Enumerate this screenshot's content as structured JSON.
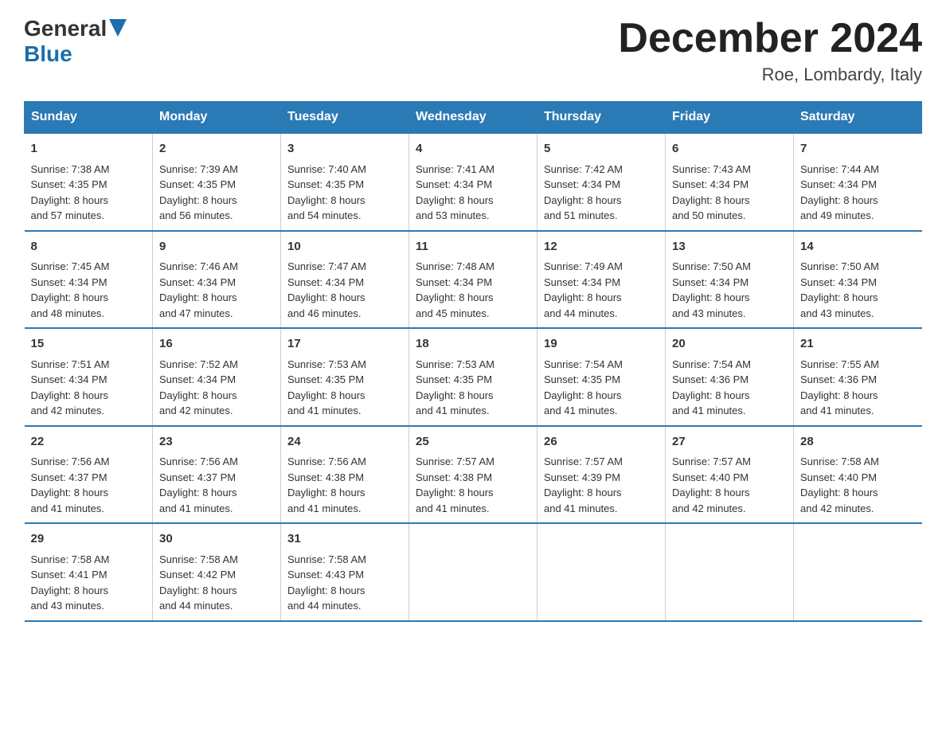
{
  "logo": {
    "general": "General",
    "arrow": "▶",
    "blue": "Blue"
  },
  "title": "December 2024",
  "location": "Roe, Lombardy, Italy",
  "days_header": [
    "Sunday",
    "Monday",
    "Tuesday",
    "Wednesday",
    "Thursday",
    "Friday",
    "Saturday"
  ],
  "weeks": [
    [
      {
        "day": "1",
        "sunrise": "7:38 AM",
        "sunset": "4:35 PM",
        "daylight": "8 hours and 57 minutes."
      },
      {
        "day": "2",
        "sunrise": "7:39 AM",
        "sunset": "4:35 PM",
        "daylight": "8 hours and 56 minutes."
      },
      {
        "day": "3",
        "sunrise": "7:40 AM",
        "sunset": "4:35 PM",
        "daylight": "8 hours and 54 minutes."
      },
      {
        "day": "4",
        "sunrise": "7:41 AM",
        "sunset": "4:34 PM",
        "daylight": "8 hours and 53 minutes."
      },
      {
        "day": "5",
        "sunrise": "7:42 AM",
        "sunset": "4:34 PM",
        "daylight": "8 hours and 51 minutes."
      },
      {
        "day": "6",
        "sunrise": "7:43 AM",
        "sunset": "4:34 PM",
        "daylight": "8 hours and 50 minutes."
      },
      {
        "day": "7",
        "sunrise": "7:44 AM",
        "sunset": "4:34 PM",
        "daylight": "8 hours and 49 minutes."
      }
    ],
    [
      {
        "day": "8",
        "sunrise": "7:45 AM",
        "sunset": "4:34 PM",
        "daylight": "8 hours and 48 minutes."
      },
      {
        "day": "9",
        "sunrise": "7:46 AM",
        "sunset": "4:34 PM",
        "daylight": "8 hours and 47 minutes."
      },
      {
        "day": "10",
        "sunrise": "7:47 AM",
        "sunset": "4:34 PM",
        "daylight": "8 hours and 46 minutes."
      },
      {
        "day": "11",
        "sunrise": "7:48 AM",
        "sunset": "4:34 PM",
        "daylight": "8 hours and 45 minutes."
      },
      {
        "day": "12",
        "sunrise": "7:49 AM",
        "sunset": "4:34 PM",
        "daylight": "8 hours and 44 minutes."
      },
      {
        "day": "13",
        "sunrise": "7:50 AM",
        "sunset": "4:34 PM",
        "daylight": "8 hours and 43 minutes."
      },
      {
        "day": "14",
        "sunrise": "7:50 AM",
        "sunset": "4:34 PM",
        "daylight": "8 hours and 43 minutes."
      }
    ],
    [
      {
        "day": "15",
        "sunrise": "7:51 AM",
        "sunset": "4:34 PM",
        "daylight": "8 hours and 42 minutes."
      },
      {
        "day": "16",
        "sunrise": "7:52 AM",
        "sunset": "4:34 PM",
        "daylight": "8 hours and 42 minutes."
      },
      {
        "day": "17",
        "sunrise": "7:53 AM",
        "sunset": "4:35 PM",
        "daylight": "8 hours and 41 minutes."
      },
      {
        "day": "18",
        "sunrise": "7:53 AM",
        "sunset": "4:35 PM",
        "daylight": "8 hours and 41 minutes."
      },
      {
        "day": "19",
        "sunrise": "7:54 AM",
        "sunset": "4:35 PM",
        "daylight": "8 hours and 41 minutes."
      },
      {
        "day": "20",
        "sunrise": "7:54 AM",
        "sunset": "4:36 PM",
        "daylight": "8 hours and 41 minutes."
      },
      {
        "day": "21",
        "sunrise": "7:55 AM",
        "sunset": "4:36 PM",
        "daylight": "8 hours and 41 minutes."
      }
    ],
    [
      {
        "day": "22",
        "sunrise": "7:56 AM",
        "sunset": "4:37 PM",
        "daylight": "8 hours and 41 minutes."
      },
      {
        "day": "23",
        "sunrise": "7:56 AM",
        "sunset": "4:37 PM",
        "daylight": "8 hours and 41 minutes."
      },
      {
        "day": "24",
        "sunrise": "7:56 AM",
        "sunset": "4:38 PM",
        "daylight": "8 hours and 41 minutes."
      },
      {
        "day": "25",
        "sunrise": "7:57 AM",
        "sunset": "4:38 PM",
        "daylight": "8 hours and 41 minutes."
      },
      {
        "day": "26",
        "sunrise": "7:57 AM",
        "sunset": "4:39 PM",
        "daylight": "8 hours and 41 minutes."
      },
      {
        "day": "27",
        "sunrise": "7:57 AM",
        "sunset": "4:40 PM",
        "daylight": "8 hours and 42 minutes."
      },
      {
        "day": "28",
        "sunrise": "7:58 AM",
        "sunset": "4:40 PM",
        "daylight": "8 hours and 42 minutes."
      }
    ],
    [
      {
        "day": "29",
        "sunrise": "7:58 AM",
        "sunset": "4:41 PM",
        "daylight": "8 hours and 43 minutes."
      },
      {
        "day": "30",
        "sunrise": "7:58 AM",
        "sunset": "4:42 PM",
        "daylight": "8 hours and 44 minutes."
      },
      {
        "day": "31",
        "sunrise": "7:58 AM",
        "sunset": "4:43 PM",
        "daylight": "8 hours and 44 minutes."
      },
      null,
      null,
      null,
      null
    ]
  ],
  "labels": {
    "sunrise": "Sunrise:",
    "sunset": "Sunset:",
    "daylight": "Daylight:"
  }
}
